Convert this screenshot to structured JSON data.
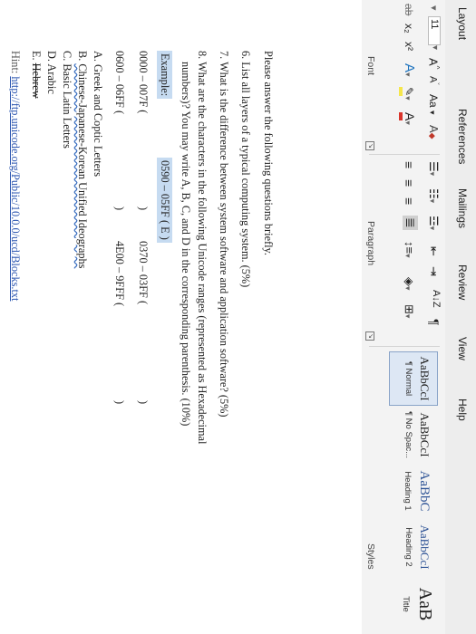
{
  "tabs": [
    "Layout",
    "References",
    "Mailings",
    "Review",
    "View",
    "Help"
  ],
  "font": {
    "size": "11",
    "grow": "A",
    "shrink": "A",
    "case": "Aa",
    "clear": "A",
    "strike": "ab",
    "sub": "x₂",
    "sup": "x²",
    "effects": "A",
    "highlight": "ab",
    "color": "A",
    "label": "Font"
  },
  "paragraph": {
    "label": "Paragraph",
    "sort": "A↓Z",
    "pilcrow": "¶"
  },
  "styles": {
    "label": "Styles",
    "items": [
      {
        "sample": "AaBbCcI",
        "name": "¶ Normal"
      },
      {
        "sample": "AaBbCcI",
        "name": "¶ No Spac..."
      },
      {
        "sample": "AaBbC",
        "name": "Heading 1"
      },
      {
        "sample": "AaBbCcI",
        "name": "Heading 2"
      },
      {
        "sample": "AaB",
        "name": "Title"
      }
    ]
  },
  "doc": {
    "intro": "Please answer the following questions briefly.",
    "q6": "6.  List all layers of a typical computing system. (5%)",
    "q7": "7.  What is the difference between system software and application software? (5%)",
    "q8a": "8.  What are the characters in the following Unicode ranges (represented as Hexadecimal",
    "q8b": "numbers)? You may write A, B, C, and D in the corresponding parenthesis. (10%)",
    "example_label": "Example:",
    "example_value": "0590 – 05FF (  E   )",
    "range1": "0000 – 007F (",
    "range2": "0370 – 03FF (",
    "range3": "0600 – 06FF (",
    "range4": "4E00 – 9FFF (",
    "close": ")",
    "opt_a": "A.  Greek and Coptic Letters",
    "opt_b_prefix": "B.  ",
    "opt_b_text": "Chinese-Japanese-Korean Unified Ideographs",
    "opt_c": "C.  Basic Latin Letters",
    "opt_d": "D.  Arabic",
    "opt_e_prefix": "E.  ",
    "opt_e_text": "Hebrew",
    "hint_label": "Hint: ",
    "hint_url": "http://ftp.unicode.org/Public/10.0.0/ucd/Blocks.txt"
  }
}
